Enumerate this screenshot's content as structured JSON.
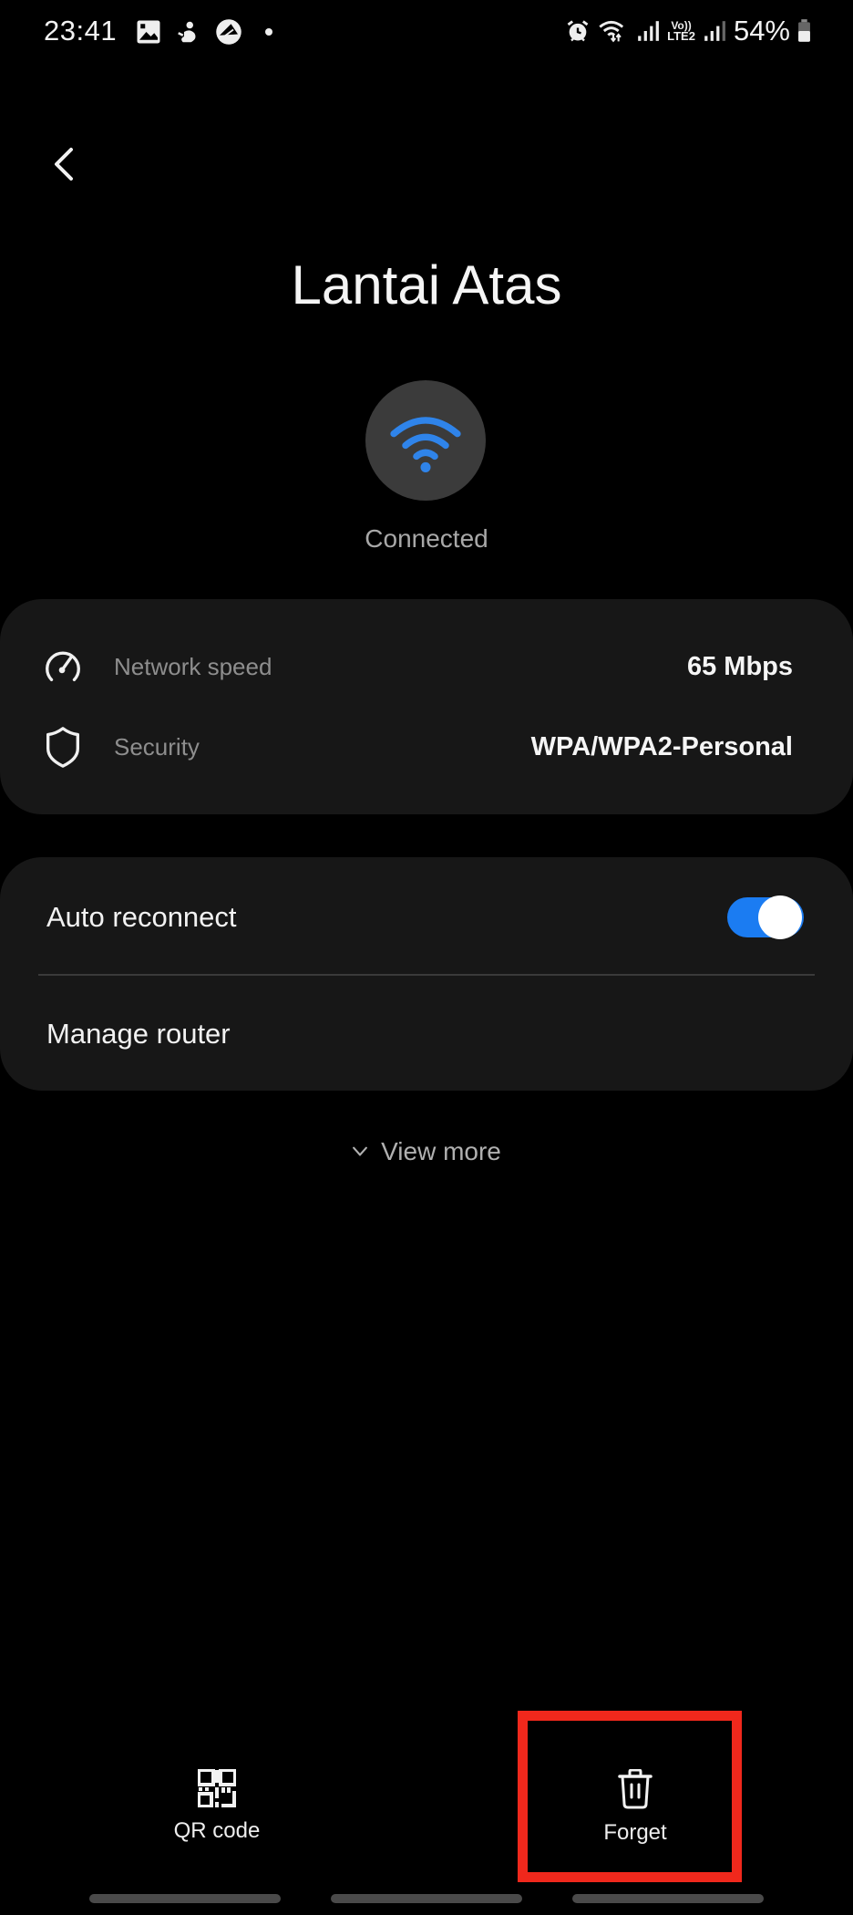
{
  "status_bar": {
    "time": "23:41",
    "left_icons": [
      "gallery-icon",
      "notification-app-icon",
      "app-logo-icon",
      "dot-icon"
    ],
    "right_icons": [
      "alarm-icon",
      "wifi-data-icon",
      "signal-1-icon",
      "volte-lte2-icon",
      "signal-2-icon"
    ],
    "volte_label_top": "Vo))",
    "volte_label_bottom": "LTE2",
    "battery_percent": "54%",
    "battery_level": 0.54
  },
  "header": {
    "back_icon": "chevron-left-icon",
    "title": "Lantai Atas"
  },
  "network": {
    "icon": "wifi-icon",
    "icon_color": "#2f84ea",
    "status": "Connected"
  },
  "info": {
    "rows": [
      {
        "icon": "speedometer-icon",
        "label": "Network speed",
        "value": "65 Mbps"
      },
      {
        "icon": "shield-icon",
        "label": "Security",
        "value": "WPA/WPA2-Personal"
      }
    ]
  },
  "settings": {
    "auto_reconnect": {
      "label": "Auto reconnect",
      "enabled": true,
      "accent": "#1b7cf2"
    },
    "manage_router": {
      "label": "Manage router"
    }
  },
  "view_more": {
    "label": "View more"
  },
  "bottom_actions": [
    {
      "icon": "qr-code-icon",
      "label": "QR code"
    },
    {
      "icon": "trash-icon",
      "label": "Forget"
    }
  ],
  "annotation": {
    "highlight_color": "#f0281c",
    "target": "Forget"
  }
}
